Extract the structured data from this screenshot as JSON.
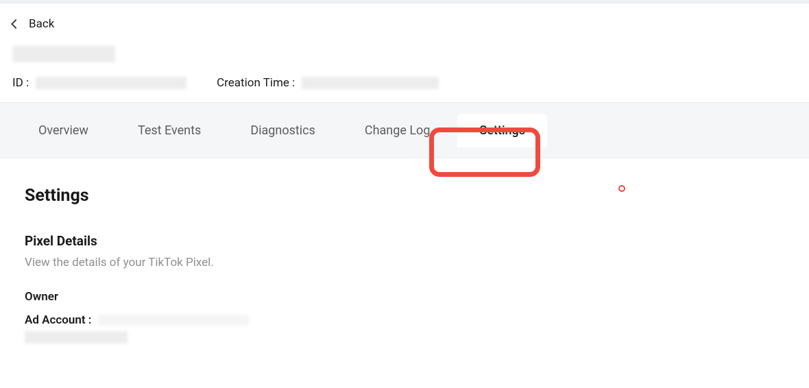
{
  "back": {
    "label": "Back"
  },
  "meta": {
    "id_label": "ID :",
    "creation_label": "Creation Time :"
  },
  "tabs": [
    {
      "label": "Overview",
      "active": false
    },
    {
      "label": "Test Events",
      "active": false
    },
    {
      "label": "Diagnostics",
      "active": false
    },
    {
      "label": "Change Log",
      "active": false
    },
    {
      "label": "Settings",
      "active": true
    }
  ],
  "page": {
    "title": "Settings",
    "section_title": "Pixel Details",
    "section_desc": "View the details of your TikTok Pixel.",
    "owner_label": "Owner",
    "ad_account_label": "Ad Account :"
  }
}
